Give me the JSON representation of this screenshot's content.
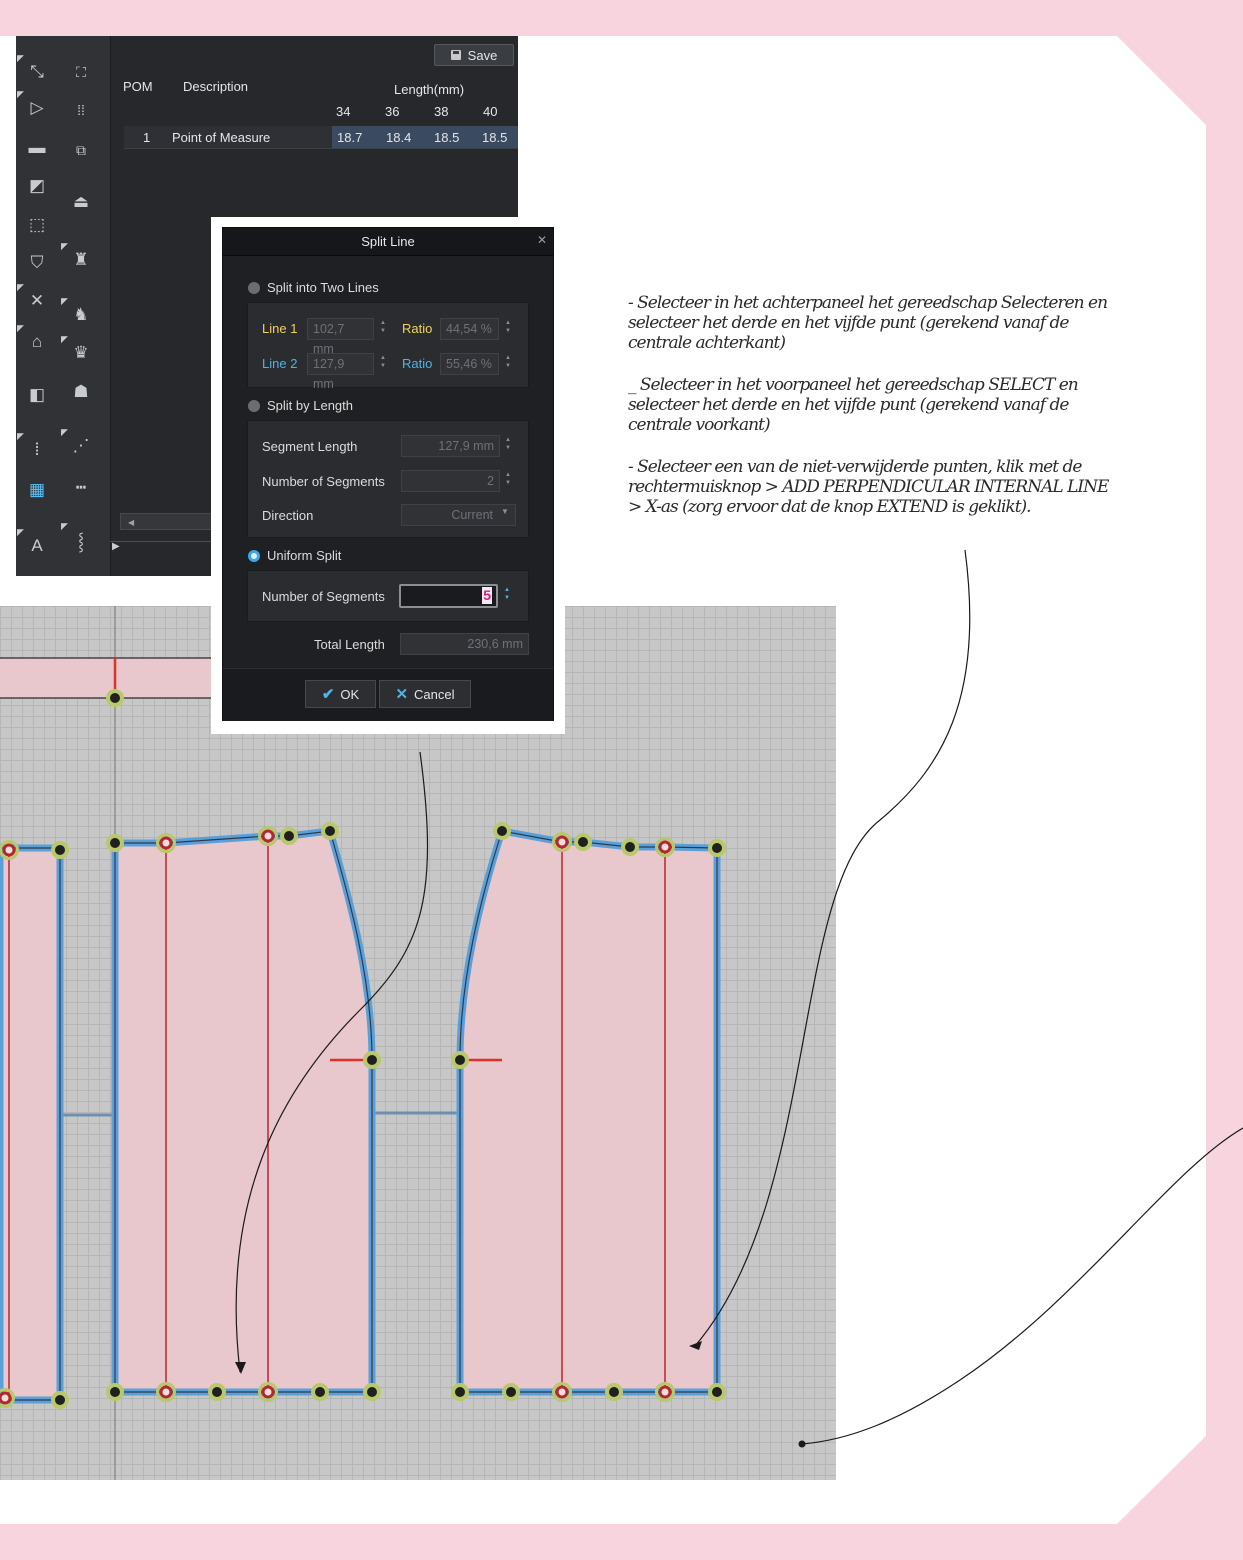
{
  "pom_table": {
    "save_label": "Save",
    "col_pom": "POM",
    "col_description": "Description",
    "col_length": "Length(mm)",
    "sizes": [
      "34",
      "36",
      "38",
      "40"
    ],
    "rows": [
      {
        "pom": "1",
        "description": "Point of Measure",
        "values": [
          "18.7",
          "18.4",
          "18.5",
          "18.5"
        ]
      }
    ]
  },
  "toolbar": {
    "tools": [
      "select-point-tool-icon",
      "segment-tool-icon",
      "rectangle-tool-icon",
      "shape-tool-icon",
      "dashed-rect-tool-icon",
      "fold-tool-icon",
      "cut-tool-icon",
      "notch-tool-icon",
      "seam-allowance-tool-icon",
      "ruler-tool-icon",
      "tape-measure-tool-icon",
      "text-tool-icon",
      "move-point-tool-icon",
      "group-tool-icon",
      "copy-tool-icon",
      "iron-tool-icon",
      "shirt-tool-icon",
      "sew-tool-icon",
      "garment-tool-icon",
      "avatar-tool-icon",
      "line-tool-icon",
      "dimension-tool-icon",
      "zipper-tool-icon"
    ]
  },
  "split_line_dialog": {
    "title": "Split Line",
    "close_icon": "close-icon",
    "option_two_lines": "Split into Two Lines",
    "line1_label": "Line 1",
    "line1_value": "102,7 mm",
    "line1_ratio_label": "Ratio",
    "line1_ratio_value": "44,54 %",
    "line2_label": "Line 2",
    "line2_value": "127,9 mm",
    "line2_ratio_label": "Ratio",
    "line2_ratio_value": "55,46 %",
    "option_by_length": "Split by Length",
    "segment_length_label": "Segment Length",
    "segment_length_value": "127,9 mm",
    "num_segments_label": "Number of Segments",
    "num_segments_value": "2",
    "direction_label": "Direction",
    "direction_value": "Current",
    "option_uniform": "Uniform Split",
    "uniform_segments_label": "Number of Segments",
    "uniform_segments_value": "5",
    "total_length_label": "Total Length",
    "total_length_value": "230,6 mm",
    "ok_label": "OK",
    "cancel_label": "Cancel",
    "selected_option": "Uniform Split"
  },
  "instructions": [
    "- Selecteer in het achterpaneel het gereedschap Selecteren en selecteer het derde en het vijfde punt (gerekend vanaf de centrale achterkant)",
    "_ Selecteer in het voorpaneel het gereedschap SELECT en selecteer het derde en het vijfde punt (gerekend vanaf de centrale voorkant)",
    "- Selecteer een van de niet-verwijderde punten, klik met de rechtermuisknop > ADD PERPENDICULAR INTERNAL LINE > X-as (zorg ervoor dat de knop EXTEND is geklikt)."
  ],
  "colors": {
    "page_background": "#f7d4de",
    "panel_fill": "#e8c8cd",
    "panel_outline": "#5b9fd8",
    "internal_line": "#b2292b",
    "accent_blue": "#4fb3e6",
    "dialog_yellow": "#f1d35a"
  }
}
